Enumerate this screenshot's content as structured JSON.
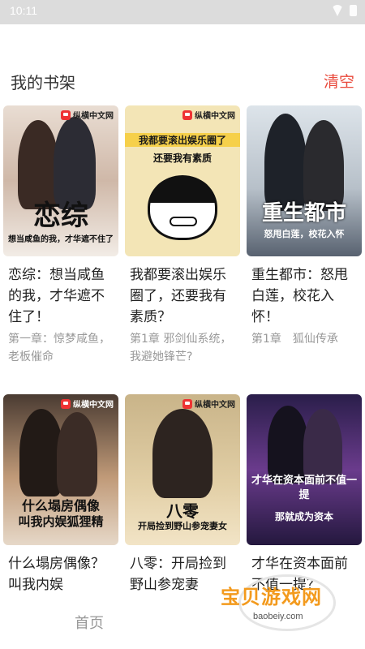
{
  "status": {
    "time": "10:11"
  },
  "header": {
    "title": "我的书架",
    "clear_label": "清空"
  },
  "books": [
    {
      "title": "恋综：想当咸鱼的我，才华遮不住了！",
      "chapter": "第一章：惊梦咸鱼，老板催命",
      "cover_big": "恋综",
      "cover_sub": "想当咸鱼的我，才华遮不住了"
    },
    {
      "title": "我都要滚出娱乐圈了，还要我有素质？",
      "chapter": "第1章 邪剑仙系统，我避她锋芒?",
      "cover_big": "我都要滚出娱乐圈了",
      "cover_sub": "还要我有素质"
    },
    {
      "title": "重生都市：怒甩白莲，校花入怀！",
      "chapter": "第1章　狐仙传承",
      "cover_big": "重生都市",
      "cover_sub": "怒甩白莲，校花入怀"
    },
    {
      "title": "什么塌房偶像？叫我内娱",
      "chapter": "",
      "cover_big": "什么塌房偶像",
      "cover_sub": "叫我内娱狐狸精"
    },
    {
      "title": "八零：开局捡到野山参宠妻",
      "chapter": "",
      "cover_big": "八零",
      "cover_sub": "开局捡到野山参宠妻女"
    },
    {
      "title": "才华在资本面前不值一提？",
      "chapter": "",
      "cover_big": "才华在资本面前不值一提",
      "cover_sub": "那就成为资本"
    }
  ],
  "publisher": "纵横中文网",
  "nav": {
    "home_label": "首页"
  },
  "watermark": {
    "text": "宝贝游戏网",
    "url": "baobeiy.com"
  },
  "colors": {
    "accent": "#e94a3c",
    "watermark": "#f39a1d"
  }
}
